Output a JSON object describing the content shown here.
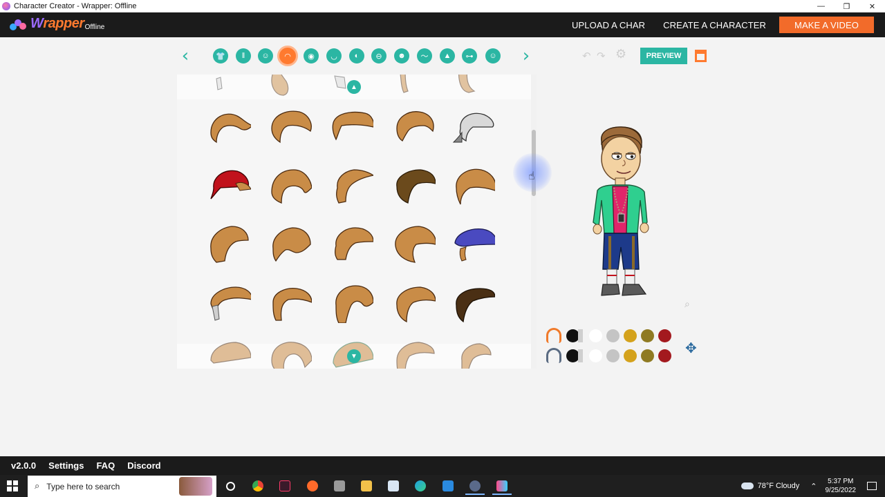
{
  "window": {
    "title": "Character Creator - Wrapper: Offline",
    "controls": [
      "—",
      "❐",
      "✕"
    ]
  },
  "header": {
    "logo_word": "rapper",
    "logo_letter": "W",
    "logo_sub": "Offline",
    "nav": {
      "upload": "UPLOAD A CHAR",
      "create": "CREATE A CHARACTER",
      "make_video": "MAKE A VIDEO"
    }
  },
  "toolbar": {
    "prev_arrow": "‹",
    "next_arrow": "›",
    "categories": [
      {
        "name": "shirt",
        "glyph": "👕"
      },
      {
        "name": "pants",
        "glyph": "‖"
      },
      {
        "name": "face",
        "glyph": "☺"
      },
      {
        "name": "hair",
        "glyph": "◠"
      },
      {
        "name": "eyes",
        "glyph": "◉"
      },
      {
        "name": "mouth",
        "glyph": "◡"
      },
      {
        "name": "ear",
        "glyph": "◐"
      },
      {
        "name": "nose",
        "glyph": "⊖"
      },
      {
        "name": "beard",
        "glyph": "☻"
      },
      {
        "name": "eyebrows",
        "glyph": "〜"
      },
      {
        "name": "hat",
        "glyph": "▲"
      },
      {
        "name": "glasses",
        "glyph": "⊶"
      },
      {
        "name": "accessory",
        "glyph": "☺"
      }
    ],
    "undo": "↶",
    "redo": "↷",
    "settings": "⚙",
    "preview_label": "PREVIEW"
  },
  "parts_panel": {
    "scroll_up": "▲",
    "scroll_down": "▼",
    "selected_category": "hair"
  },
  "palette": {
    "colors": [
      "#111111",
      "#ffffff",
      "#c4c4c4",
      "#d4a21c",
      "#8f7a22",
      "#a3191e"
    ],
    "primary_part_color": "#f07a2a",
    "secondary_part_color": "#5a6b82"
  },
  "icons": {
    "zoom": "⌕",
    "move": "✥"
  },
  "footer": {
    "version": "v2.0.0",
    "settings": "Settings",
    "faq": "FAQ",
    "discord": "Discord"
  },
  "taskbar": {
    "search_placeholder": "Type here to search",
    "weather": "78°F  Cloudy",
    "time": "5:37 PM",
    "date": "9/25/2022"
  }
}
